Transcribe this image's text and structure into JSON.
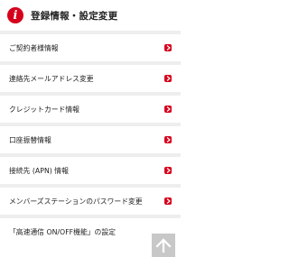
{
  "header": {
    "logo_glyph": "i",
    "title": "登録情報・設定変更"
  },
  "menu": {
    "items": [
      {
        "label": "ご契約者様情報"
      },
      {
        "label": "連絡先メールアドレス変更"
      },
      {
        "label": "クレジットカード情報"
      },
      {
        "label": "口座振替情報"
      },
      {
        "label": "接続先 (APN) 情報"
      },
      {
        "label": "メンバーズステーションのパスワード変更"
      },
      {
        "label": "「高速通信 ON/OFF機能」の設定"
      }
    ]
  },
  "colors": {
    "accent": "#d6001c",
    "background": "#eeeeee",
    "pagetop": "#c8c8c8"
  }
}
